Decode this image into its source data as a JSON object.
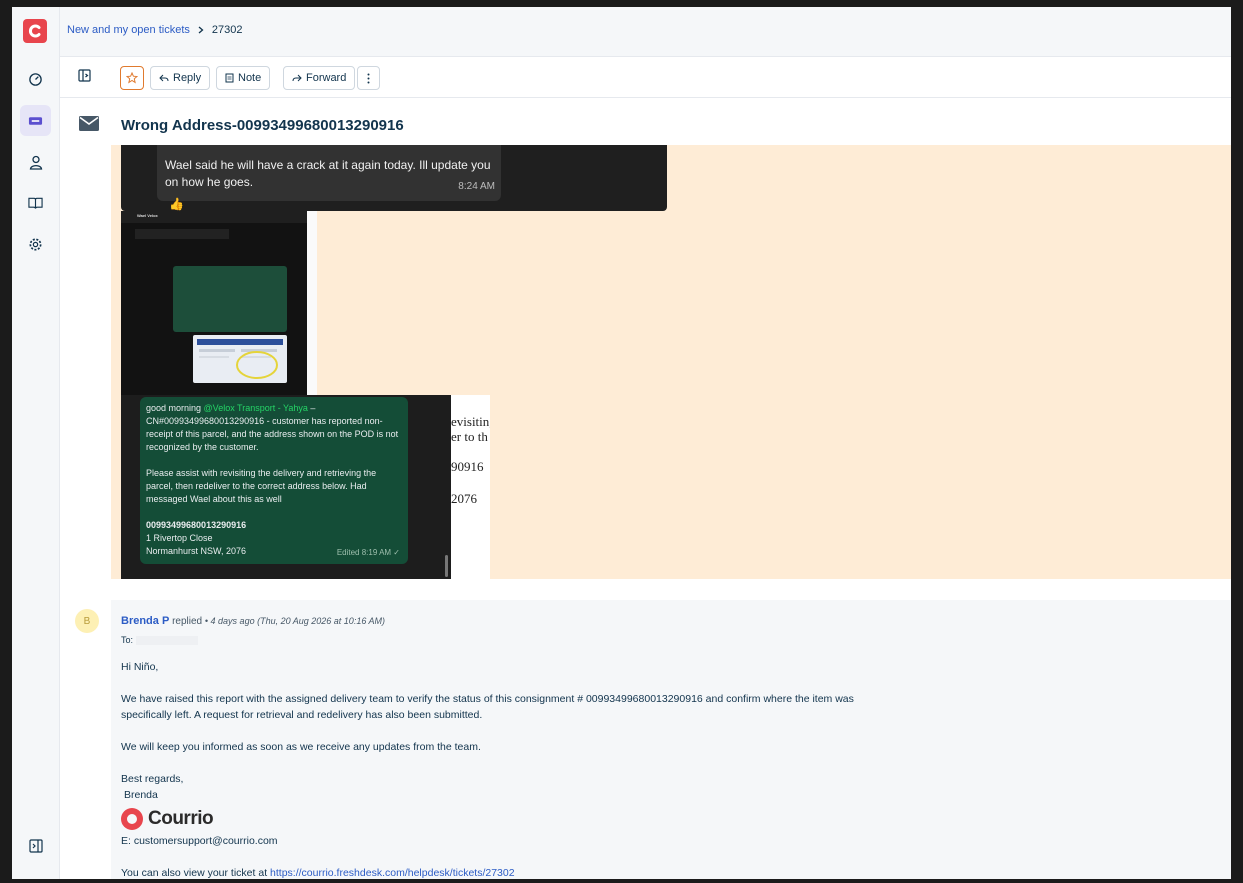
{
  "breadcrumb": {
    "parent": "New and my open tickets",
    "current": "27302"
  },
  "toolbar": {
    "reply": "Reply",
    "note": "Note",
    "forward": "Forward"
  },
  "ticket": {
    "subject": "Wrong Address-00993499680013290916"
  },
  "whatsapp1": {
    "text": "Wael said he will have a crack at it again today. Ill update you on how he goes.",
    "time": "8:24 AM"
  },
  "whatsapp2": {
    "contact": "Wael Velox"
  },
  "whatsapp3": {
    "greeting": "good morning ",
    "mention": "@Velox Transport - Yahya",
    "dash": " –",
    "p1": "CN#00993499680013290916 - customer has reported non-receipt of this parcel, and the address shown on the POD is not recognized by the customer.",
    "p2": "Please assist with revisiting the delivery and retrieving the parcel, then redeliver to the correct address below. Had messaged Wael about this as well",
    "cn": "00993499680013290916",
    "addr1": "1 Rivertop Close",
    "addr2": "Normanhurst NSW, 2076",
    "edited": "Edited 8:19 AM ✓",
    "doc": [
      "evisiting",
      "er to th",
      "90916",
      "2076"
    ]
  },
  "reply": {
    "avatar": "B",
    "author": "Brenda P",
    "action": "replied",
    "when": "• 4 days ago (Thu, 20 Aug 2026 at 10:16 AM)",
    "to_label": "To:",
    "greeting": "Hi Niño,",
    "p1": "We have raised this report with the assigned delivery team to verify the status of this consignment # 00993499680013290916 and confirm where the item was specifically left. A request for retrieval and redelivery has also been submitted.",
    "p2": "We will keep you informed as soon as we receive any updates from the team.",
    "regards": "Best regards,",
    "name": "Brenda",
    "brand": "Courrio",
    "email": "E: customersupport@courrio.com",
    "view_prefix": "You can also view your ticket at ",
    "ticket_url": "https://courrio.freshdesk.com/helpdesk/tickets/27302"
  },
  "colors": {
    "accent": "#2c5cc5",
    "brand": "#e8454d",
    "quote_bg": "#feecd6"
  }
}
